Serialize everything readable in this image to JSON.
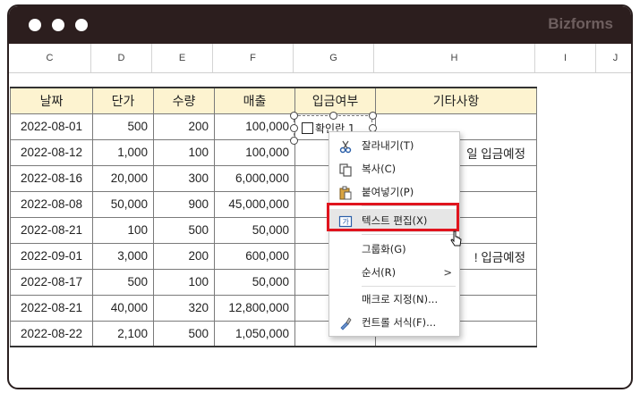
{
  "app": {
    "brand": "Bizforms"
  },
  "columns": [
    "C",
    "D",
    "E",
    "F",
    "G",
    "H",
    "I",
    "J"
  ],
  "table": {
    "headers": [
      "날짜",
      "단가",
      "수량",
      "매출",
      "입금여부",
      "기타사항"
    ],
    "rows": [
      [
        "2022-08-01",
        "500",
        "200",
        "100,000",
        "",
        ""
      ],
      [
        "2022-08-12",
        "1,000",
        "100",
        "100,000",
        "",
        "일 입금예정"
      ],
      [
        "2022-08-16",
        "20,000",
        "300",
        "6,000,000",
        "",
        ""
      ],
      [
        "2022-08-08",
        "50,000",
        "900",
        "45,000,000",
        "",
        ""
      ],
      [
        "2022-08-21",
        "100",
        "500",
        "50,000",
        "",
        ""
      ],
      [
        "2022-09-01",
        "3,000",
        "200",
        "600,000",
        "",
        "! 입금예정"
      ],
      [
        "2022-08-17",
        "500",
        "100",
        "50,000",
        "",
        ""
      ],
      [
        "2022-08-21",
        "40,000",
        "320",
        "12,800,000",
        "",
        ""
      ],
      [
        "2022-08-22",
        "2,100",
        "500",
        "1,050,000",
        "",
        ""
      ]
    ]
  },
  "checkbox": {
    "label": "확인란 1"
  },
  "context_menu": {
    "items": [
      {
        "label": "잘라내기(T)",
        "icon": "scissors-icon"
      },
      {
        "label": "복사(C)",
        "icon": "copy-icon"
      },
      {
        "label": "붙여넣기(P)",
        "icon": "paste-icon"
      },
      {
        "label": "텍스트 편집(X)",
        "icon": "text-edit-icon"
      },
      {
        "label": "그룹화(G)",
        "icon": ""
      },
      {
        "label": "순서(R)",
        "icon": ""
      },
      {
        "label": "매크로 지정(N)...",
        "icon": ""
      },
      {
        "label": "컨트롤 서식(F)...",
        "icon": "format-control-icon"
      }
    ],
    "submenu_arrow": ">"
  },
  "colors": {
    "titlebar": "#2c1e1e",
    "header_fill": "#fdf3d0",
    "highlight": "#e0141e"
  }
}
